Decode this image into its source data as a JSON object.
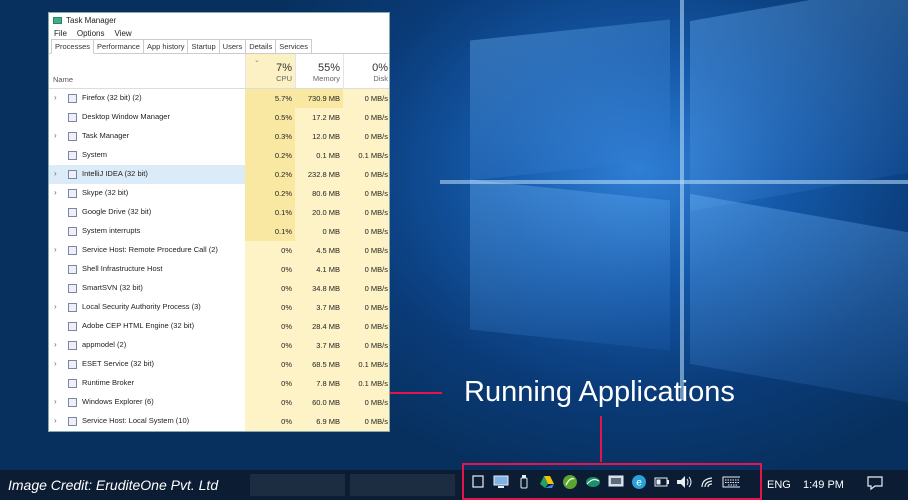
{
  "window": {
    "title": "Task Manager"
  },
  "menu": [
    "File",
    "Options",
    "View"
  ],
  "tabs": [
    "Processes",
    "Performance",
    "App history",
    "Startup",
    "Users",
    "Details",
    "Services"
  ],
  "columns": {
    "name": "Name",
    "cpu": {
      "pct": "7%",
      "label": "CPU"
    },
    "memory": {
      "pct": "55%",
      "label": "Memory"
    },
    "disk": {
      "pct": "0%",
      "label": "Disk"
    }
  },
  "processes": [
    {
      "name": "Firefox (32 bit) (2)",
      "cpu": "5.7%",
      "memory": "730.9 MB",
      "disk": "0 MB/s",
      "expandable": true,
      "icon": "firefox-icon"
    },
    {
      "name": "Desktop Window Manager",
      "cpu": "0.5%",
      "memory": "17.2 MB",
      "disk": "0 MB/s",
      "expandable": false,
      "icon": "window-icon"
    },
    {
      "name": "Task Manager",
      "cpu": "0.3%",
      "memory": "12.0 MB",
      "disk": "0 MB/s",
      "expandable": true,
      "icon": "task-manager-icon"
    },
    {
      "name": "System",
      "cpu": "0.2%",
      "memory": "0.1 MB",
      "disk": "0.1 MB/s",
      "expandable": false,
      "icon": "window-icon"
    },
    {
      "name": "IntelliJ IDEA (32 bit)",
      "cpu": "0.2%",
      "memory": "232.8 MB",
      "disk": "0 MB/s",
      "expandable": true,
      "icon": "intellij-icon"
    },
    {
      "name": "Skype (32 bit)",
      "cpu": "0.2%",
      "memory": "80.6 MB",
      "disk": "0 MB/s",
      "expandable": true,
      "icon": "skype-icon"
    },
    {
      "name": "Google Drive (32 bit)",
      "cpu": "0.1%",
      "memory": "20.0 MB",
      "disk": "0 MB/s",
      "expandable": false,
      "icon": "google-drive-icon"
    },
    {
      "name": "System interrupts",
      "cpu": "0.1%",
      "memory": "0 MB",
      "disk": "0 MB/s",
      "expandable": false,
      "icon": "window-icon"
    },
    {
      "name": "Service Host: Remote Procedure Call (2)",
      "cpu": "0%",
      "memory": "4.5 MB",
      "disk": "0 MB/s",
      "expandable": true,
      "icon": "gear-icon"
    },
    {
      "name": "Shell Infrastructure Host",
      "cpu": "0%",
      "memory": "4.1 MB",
      "disk": "0 MB/s",
      "expandable": false,
      "icon": "window-icon"
    },
    {
      "name": "SmartSVN (32 bit)",
      "cpu": "0%",
      "memory": "34.8 MB",
      "disk": "0 MB/s",
      "expandable": false,
      "icon": "smartsvn-icon"
    },
    {
      "name": "Local Security Authority Process (3)",
      "cpu": "0%",
      "memory": "3.7 MB",
      "disk": "0 MB/s",
      "expandable": true,
      "icon": "window-icon"
    },
    {
      "name": "Adobe CEP HTML Engine (32 bit)",
      "cpu": "0%",
      "memory": "28.4 MB",
      "disk": "0 MB/s",
      "expandable": false,
      "icon": "window-icon"
    },
    {
      "name": "appmodel (2)",
      "cpu": "0%",
      "memory": "3.7 MB",
      "disk": "0 MB/s",
      "expandable": true,
      "icon": "gear-icon"
    },
    {
      "name": "ESET Service (32 bit)",
      "cpu": "0%",
      "memory": "68.5 MB",
      "disk": "0.1 MB/s",
      "expandable": true,
      "icon": "eset-icon"
    },
    {
      "name": "Runtime Broker",
      "cpu": "0%",
      "memory": "7.8 MB",
      "disk": "0.1 MB/s",
      "expandable": false,
      "icon": "window-icon"
    },
    {
      "name": "Windows Explorer (6)",
      "cpu": "0%",
      "memory": "60.0 MB",
      "disk": "0 MB/s",
      "expandable": true,
      "icon": "folder-icon"
    },
    {
      "name": "Service Host: Local System (10)",
      "cpu": "0%",
      "memory": "6.9 MB",
      "disk": "0 MB/s",
      "expandable": true,
      "icon": "gear-icon"
    }
  ],
  "annotation": {
    "label": "Running Applications"
  },
  "credit": "Image Credit: EruditeOne Pvt. Ltd",
  "taskbar": {
    "language": "ENG",
    "time": "1:49 PM"
  },
  "tray_icons": [
    "blank-window-icon",
    "monitor-icon",
    "usb-icon",
    "google-drive-icon",
    "leaf-icon",
    "eset-icon",
    "screen-icon",
    "e-badge-icon",
    "battery-icon",
    "volume-icon",
    "wifi-icon",
    "keyboard-icon"
  ],
  "colors": {
    "accent": "#e3154c",
    "cpu_highlight": "#f9e8a2",
    "selected_row": "#dcebf8"
  }
}
